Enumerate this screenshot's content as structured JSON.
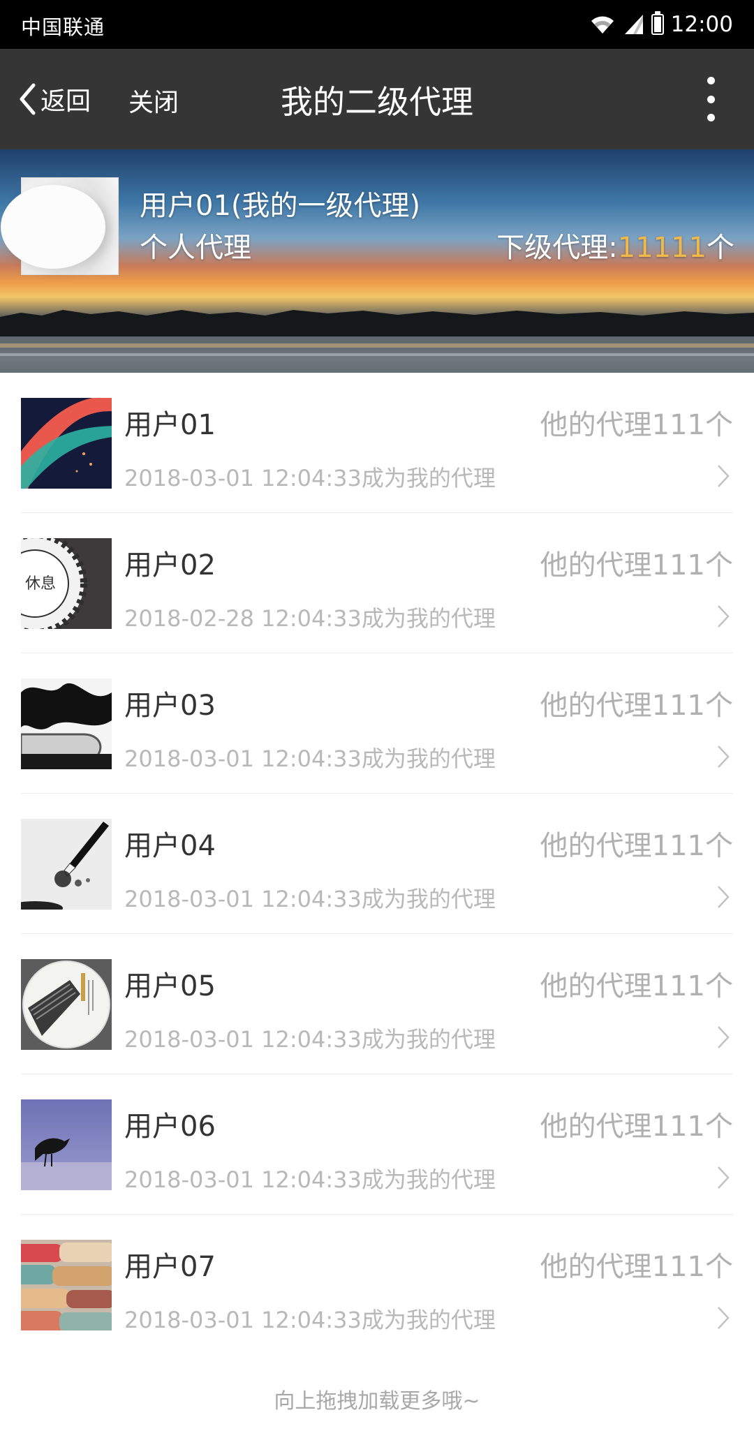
{
  "status_bar": {
    "carrier": "中国联通",
    "time": "12:00"
  },
  "nav": {
    "back_label": "返回",
    "close_label": "关闭",
    "title": "我的二级代理"
  },
  "header": {
    "name": "用户01(我的一级代理)",
    "type": "个人代理",
    "sub_label": "下级代理:",
    "sub_count": "11111",
    "sub_unit": "个"
  },
  "agents": [
    {
      "name": "用户01",
      "sub_count": "他的代理111个",
      "date": "2018-03-01 12:04:33成为我的代理"
    },
    {
      "name": "用户02",
      "sub_count": "他的代理111个",
      "date": "2018-02-28 12:04:33成为我的代理"
    },
    {
      "name": "用户03",
      "sub_count": "他的代理111个",
      "date": "2018-03-01 12:04:33成为我的代理"
    },
    {
      "name": "用户04",
      "sub_count": "他的代理111个",
      "date": "2018-03-01 12:04:33成为我的代理"
    },
    {
      "name": "用户05",
      "sub_count": "他的代理111个",
      "date": "2018-03-01 12:04:33成为我的代理"
    },
    {
      "name": "用户06",
      "sub_count": "他的代理111个",
      "date": "2018-03-01 12:04:33成为我的代理"
    },
    {
      "name": "用户07",
      "sub_count": "他的代理111个",
      "date": "2018-03-01 12:04:33成为我的代理"
    }
  ],
  "avatar_text": {
    "rest_sign": "休息"
  },
  "load_more": "向上拖拽加载更多哦~",
  "colors": {
    "status_bar": "#000000",
    "nav_bar": "#353535",
    "accent_count": "#f0b94a",
    "secondary_text": "#b0b0b0"
  },
  "icons": {
    "back": "chevron-left-icon",
    "more": "more-vertical-icon",
    "row_arrow": "chevron-right-icon",
    "wifi": "wifi-icon",
    "signal": "signal-icon",
    "battery": "battery-icon"
  }
}
